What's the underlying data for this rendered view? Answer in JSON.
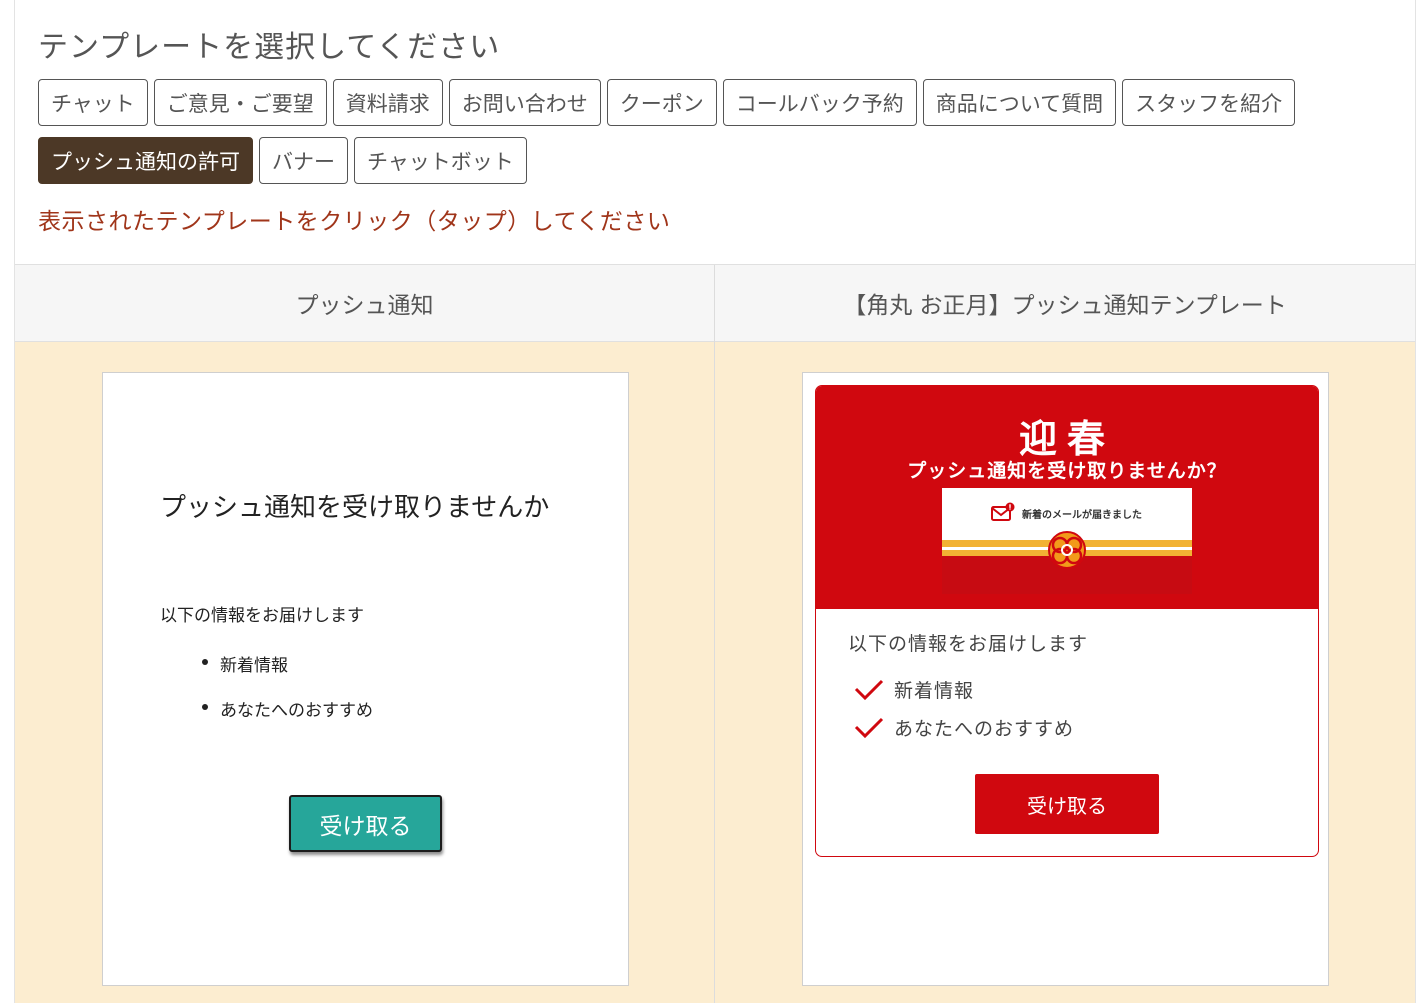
{
  "page": {
    "title": "テンプレートを選択してください",
    "hint": "表示されたテンプレートをクリック（タップ）してください"
  },
  "categories": [
    {
      "label": "チャット",
      "active": false
    },
    {
      "label": "ご意見・ご要望",
      "active": false
    },
    {
      "label": "資料請求",
      "active": false
    },
    {
      "label": "お問い合わせ",
      "active": false
    },
    {
      "label": "クーポン",
      "active": false
    },
    {
      "label": "コールバック予約",
      "active": false
    },
    {
      "label": "商品について質問",
      "active": false
    },
    {
      "label": "スタッフを紹介",
      "active": false
    },
    {
      "label": "プッシュ通知の許可",
      "active": true
    },
    {
      "label": "バナー",
      "active": false
    },
    {
      "label": "チャットボット",
      "active": false
    }
  ],
  "templates": [
    {
      "name": "プッシュ通知",
      "heading": "プッシュ通知を受け取りませんか",
      "description": "以下の情報をお届けします",
      "items": [
        "新着情報",
        "あなたへのおすすめ"
      ],
      "button": "受け取る",
      "button_color": "#26a69a"
    },
    {
      "name": "【角丸 お正月】プッシュ通知テンプレート",
      "greeting": "迎春",
      "question": "プッシュ通知を受け取りませんか？",
      "image_text": "新着のメールが届きました",
      "description": "以下の情報をお届けします",
      "items": [
        "新着情報",
        "あなたへのおすすめ"
      ],
      "button": "受け取る",
      "accent_color": "#d0080f"
    }
  ],
  "colors": {
    "active_chip": "#4c3826",
    "hint_text": "#a0351a",
    "template_area_bg": "#fcedd0"
  }
}
